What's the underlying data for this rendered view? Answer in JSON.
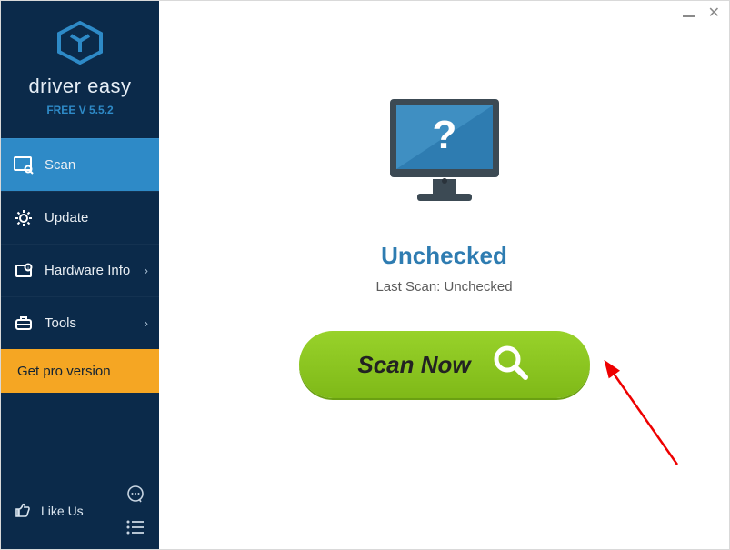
{
  "brand": {
    "name_a": "driver",
    "name_b": "easy",
    "version_label": "FREE V 5.5.2"
  },
  "sidebar": {
    "items": [
      {
        "label": "Scan",
        "icon": "scan-icon",
        "active": true,
        "chevron": false
      },
      {
        "label": "Update",
        "icon": "gear-icon",
        "active": false,
        "chevron": false
      },
      {
        "label": "Hardware Info",
        "icon": "hardware-icon",
        "active": false,
        "chevron": true
      },
      {
        "label": "Tools",
        "icon": "tools-icon",
        "active": false,
        "chevron": true
      }
    ],
    "get_pro_label": "Get pro version",
    "like_us_label": "Like Us"
  },
  "main": {
    "status_title": "Unchecked",
    "status_sub": "Last Scan: Unchecked",
    "scan_button_label": "Scan Now"
  }
}
